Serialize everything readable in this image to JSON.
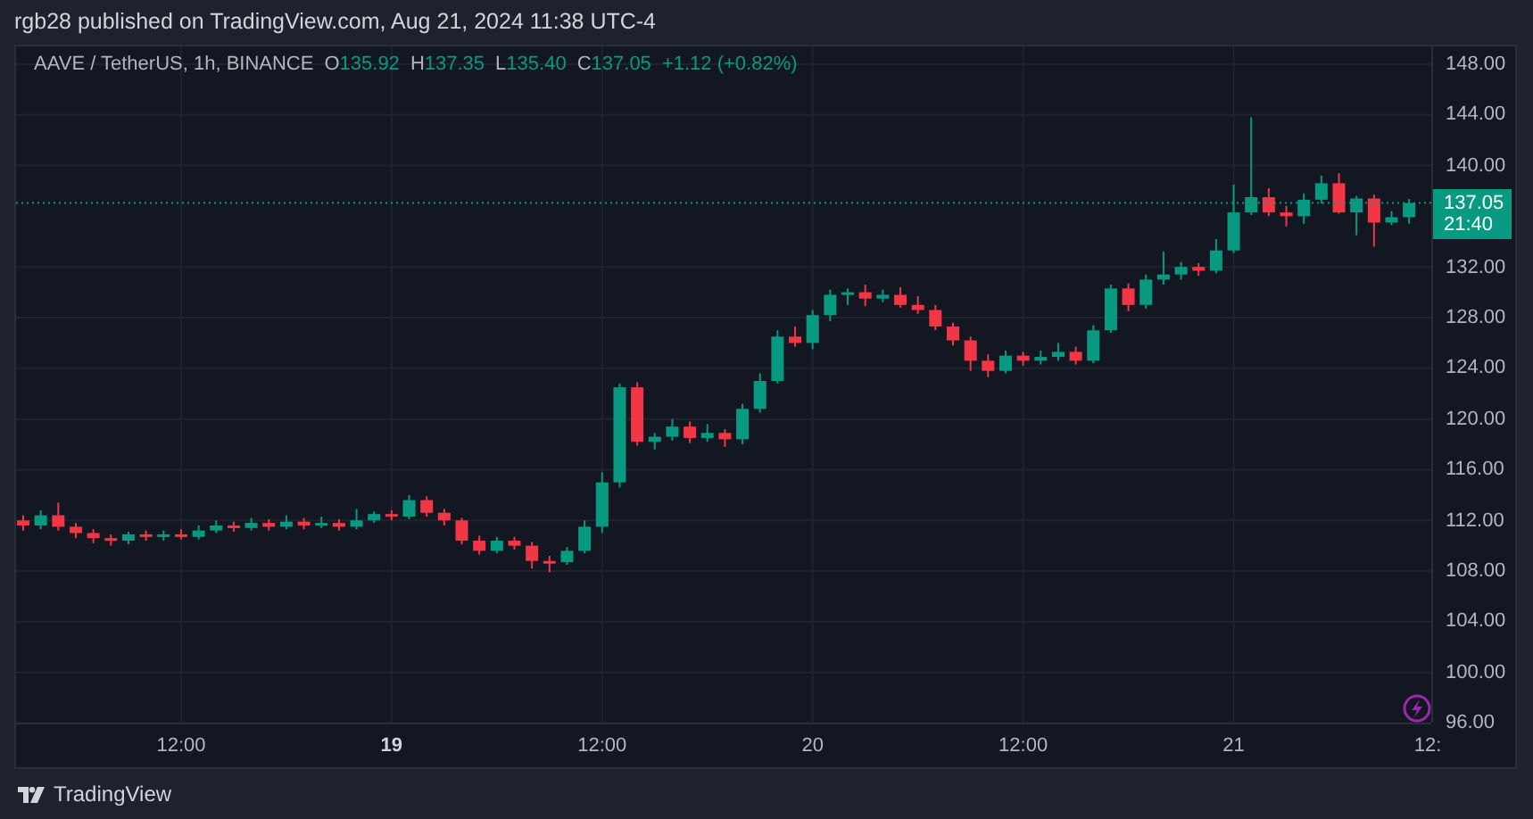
{
  "caption": "rgb28 published on TradingView.com, Aug 21, 2024 11:38 UTC-4",
  "legend": {
    "symbol": "AAVE / TetherUS, 1h, BINANCE",
    "ohlc": [
      {
        "label": "O",
        "value": "135.92"
      },
      {
        "label": "H",
        "value": "137.35"
      },
      {
        "label": "L",
        "value": "135.40"
      },
      {
        "label": "C",
        "value": "137.05"
      }
    ],
    "change": "+1.12 (+0.82%)"
  },
  "chart_data": {
    "type": "candlestick",
    "ylim": [
      95.9,
      149.4
    ],
    "grid": true,
    "ref_lines": [
      {
        "axis": "y",
        "value": 137.05,
        "color": "#089981"
      }
    ],
    "categories": [
      null,
      null,
      null,
      null,
      null,
      null,
      null,
      null,
      null,
      "12:00",
      null,
      null,
      null,
      null,
      null,
      null,
      null,
      null,
      null,
      null,
      null,
      "19",
      null,
      null,
      null,
      null,
      null,
      null,
      null,
      null,
      null,
      null,
      null,
      "12:00",
      null,
      null,
      null,
      null,
      null,
      null,
      null,
      null,
      null,
      null,
      null,
      "20",
      null,
      null,
      null,
      null,
      null,
      null,
      null,
      null,
      null,
      null,
      null,
      "12:00",
      null,
      null,
      null,
      null,
      null,
      null,
      null,
      null,
      null,
      null,
      null,
      "21",
      null,
      null,
      null,
      null,
      null,
      null,
      null,
      null,
      null,
      null
    ],
    "yticks": [
      {
        "value": 148,
        "label": "148.00"
      },
      {
        "value": 144,
        "label": "144.00"
      },
      {
        "value": 140,
        "label": "140.00"
      },
      {
        "value": 132,
        "label": "132.00"
      },
      {
        "value": 128,
        "label": "128.00"
      },
      {
        "value": 124,
        "label": "124.00"
      },
      {
        "value": 120,
        "label": "120.00"
      },
      {
        "value": 116,
        "label": "116.00"
      },
      {
        "value": 112,
        "label": "112.00"
      },
      {
        "value": 108,
        "label": "108.00"
      },
      {
        "value": 104,
        "label": "104.00"
      },
      {
        "value": 100,
        "label": "100.00"
      },
      {
        "value": 96,
        "label": "96.00"
      }
    ],
    "ohlc": [
      [
        112,
        112.4,
        111.2,
        111.6
      ],
      [
        111.6,
        112.8,
        111.3,
        112.4
      ],
      [
        112.4,
        113.4,
        111.2,
        111.5
      ],
      [
        111.5,
        111.8,
        110.6,
        111.0
      ],
      [
        111.0,
        111.3,
        110.2,
        110.6
      ],
      [
        110.6,
        110.9,
        110.0,
        110.4
      ],
      [
        110.4,
        111.1,
        110.1,
        110.9
      ],
      [
        110.9,
        111.2,
        110.4,
        110.7
      ],
      [
        110.7,
        111.2,
        110.4,
        110.9
      ],
      [
        110.9,
        111.3,
        110.5,
        110.7
      ],
      [
        110.7,
        111.6,
        110.5,
        111.2
      ],
      [
        111.2,
        112.0,
        111.0,
        111.6
      ],
      [
        111.6,
        111.9,
        111.1,
        111.4
      ],
      [
        111.4,
        112.2,
        111.2,
        111.8
      ],
      [
        111.8,
        112.1,
        111.2,
        111.5
      ],
      [
        111.5,
        112.4,
        111.3,
        111.9
      ],
      [
        111.9,
        112.2,
        111.3,
        111.6
      ],
      [
        111.6,
        112.3,
        111.4,
        111.8
      ],
      [
        111.8,
        112.1,
        111.2,
        111.5
      ],
      [
        111.5,
        112.9,
        111.3,
        112
      ],
      [
        112,
        112.7,
        111.8,
        112.5
      ],
      [
        112.5,
        112.8,
        112.0,
        112.3
      ],
      [
        112.3,
        114.0,
        112.1,
        113.6
      ],
      [
        113.6,
        113.9,
        112.3,
        112.6
      ],
      [
        112.6,
        112.9,
        111.6,
        112.0
      ],
      [
        112.0,
        112.2,
        110.1,
        110.4
      ],
      [
        110.4,
        110.8,
        109.3,
        109.6
      ],
      [
        109.6,
        110.7,
        109.4,
        110.4
      ],
      [
        110.4,
        110.7,
        109.7,
        110.0
      ],
      [
        110.0,
        110.3,
        108.2,
        108.8
      ],
      [
        108.8,
        109.2,
        107.9,
        108.7
      ],
      [
        108.7,
        109.9,
        108.5,
        109.6
      ],
      [
        109.6,
        112.0,
        109.4,
        111.5
      ],
      [
        111.5,
        115.8,
        111.0,
        115
      ],
      [
        115,
        122.8,
        114.6,
        122.5
      ],
      [
        122.5,
        122.9,
        117.9,
        118.2
      ],
      [
        118.2,
        118.9,
        117.6,
        118.6
      ],
      [
        118.6,
        120.0,
        118.3,
        119.4
      ],
      [
        119.4,
        119.8,
        118.1,
        118.5
      ],
      [
        118.5,
        119.6,
        118.2,
        118.9
      ],
      [
        118.9,
        119.2,
        117.8,
        118.4
      ],
      [
        118.4,
        121.2,
        118.0,
        120.8
      ],
      [
        120.8,
        123.6,
        120.5,
        123
      ],
      [
        123,
        127.0,
        122.8,
        126.5
      ],
      [
        126.5,
        127.3,
        125.7,
        126
      ],
      [
        126,
        128.6,
        125.5,
        128.2
      ],
      [
        128.2,
        130.2,
        127.7,
        129.8
      ],
      [
        129.8,
        130.3,
        129.0,
        130
      ],
      [
        130,
        130.6,
        128.9,
        129.5
      ],
      [
        129.5,
        130.2,
        129.2,
        129.8
      ],
      [
        129.8,
        130.4,
        128.8,
        129
      ],
      [
        129,
        129.7,
        128.3,
        128.6
      ],
      [
        128.6,
        129.0,
        127.0,
        127.3
      ],
      [
        127.3,
        127.6,
        125.8,
        126.2
      ],
      [
        126.2,
        126.5,
        123.8,
        124.6
      ],
      [
        124.6,
        125.1,
        123.3,
        123.8
      ],
      [
        123.8,
        125.4,
        123.6,
        125
      ],
      [
        125,
        125.3,
        124.2,
        124.6
      ],
      [
        124.6,
        125.4,
        124.3,
        124.9
      ],
      [
        124.9,
        126.0,
        124.6,
        125.3
      ],
      [
        125.3,
        125.7,
        124.3,
        124.6
      ],
      [
        124.6,
        127.4,
        124.4,
        127
      ],
      [
        127,
        130.6,
        126.8,
        130.3
      ],
      [
        130.3,
        130.7,
        128.5,
        129
      ],
      [
        129,
        131.4,
        128.7,
        131
      ],
      [
        131,
        133.2,
        130.6,
        131.4
      ],
      [
        131.4,
        132.4,
        131.0,
        132
      ],
      [
        132,
        132.3,
        131.3,
        131.7
      ],
      [
        131.7,
        134.2,
        131.5,
        133.3
      ],
      [
        133.3,
        138.5,
        133.1,
        136.3
      ],
      [
        136.3,
        143.8,
        136.1,
        137.5
      ],
      [
        137.5,
        138.2,
        136.0,
        136.3
      ],
      [
        136.3,
        136.8,
        135.2,
        136
      ],
      [
        136,
        137.8,
        135.4,
        137.3
      ],
      [
        137.3,
        139.2,
        137.0,
        138.6
      ],
      [
        138.6,
        139.4,
        136.2,
        136.3
      ],
      [
        136.3,
        137.6,
        134.5,
        137.4
      ],
      [
        137.4,
        137.7,
        133.6,
        135.5
      ],
      [
        135.5,
        136.4,
        135.3,
        135.92
      ],
      [
        135.92,
        137.35,
        135.4,
        137.05
      ]
    ]
  },
  "time_axis": [
    {
      "bold": false
    },
    {
      "bold": true
    },
    {
      "bold": false
    },
    {
      "bold": false
    },
    {
      "bold": false
    },
    {
      "bold": false
    },
    {
      "bold": false
    }
  ],
  "time_axis_edge_label": "12:",
  "last_price": {
    "price": "137.05",
    "countdown": "21:40"
  },
  "footer": {
    "brand": "TradingView"
  }
}
